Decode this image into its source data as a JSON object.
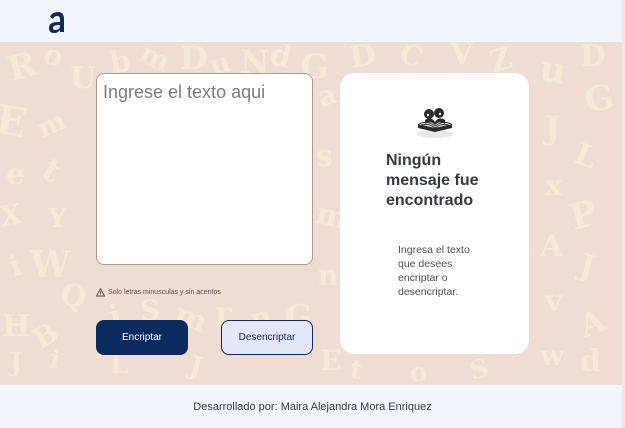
{
  "header": {
    "logo_icon": "alura-a-logo-icon",
    "brand_color": "#0b2a5e"
  },
  "input": {
    "placeholder": "Ingrese el texto aqui",
    "hint": "Solo letras minusculas y sin acentos",
    "hint_icon": "warning-triangle-icon"
  },
  "buttons": {
    "encrypt_label": "Encriptar",
    "decrypt_label": "Desencriptar"
  },
  "output": {
    "icon": "reading-book-icon",
    "title": "Ningún mensaje fue encontrado",
    "message": "Ingresa el texto que desees encriptar o desencriptar."
  },
  "footer": {
    "credit": "Desarrollado por: Maira Alejandra Mora Enriquez"
  },
  "colors": {
    "accent": "#0b2a5e",
    "background_pattern": "#efdcd3",
    "letters": "#f8ecd6"
  }
}
